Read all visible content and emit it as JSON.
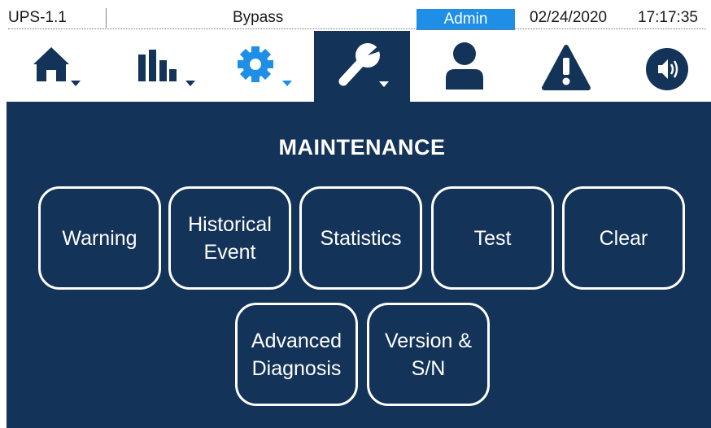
{
  "status_bar": {
    "device_id": "UPS-1.1",
    "mode": "Bypass",
    "user": "Admin",
    "date": "02/24/2020",
    "time": "17:17:35"
  },
  "nav": {
    "tabs": [
      {
        "icon": "home-icon",
        "active": false,
        "has_dropdown": true
      },
      {
        "icon": "bar-chart-icon",
        "active": false,
        "has_dropdown": true
      },
      {
        "icon": "gear-icon",
        "active": false,
        "has_dropdown": true
      },
      {
        "icon": "wrench-icon",
        "active": true,
        "has_dropdown": true
      },
      {
        "icon": "user-icon",
        "active": false,
        "has_dropdown": false
      },
      {
        "icon": "warning-icon",
        "active": false,
        "has_dropdown": false
      },
      {
        "icon": "speaker-icon",
        "active": false,
        "has_dropdown": false
      }
    ]
  },
  "page": {
    "title": "MAINTENANCE"
  },
  "buttons": {
    "warning": [
      "Warning"
    ],
    "historical_event": [
      "Historical",
      "Event"
    ],
    "statistics": [
      "Statistics"
    ],
    "test": [
      "Test"
    ],
    "clear": [
      "Clear"
    ],
    "advanced_diagnosis": [
      "Advanced",
      "Diagnosis"
    ],
    "version_sn": [
      "Version &",
      "S/N"
    ]
  },
  "colors": {
    "panel": "#143359",
    "icon": "#143359",
    "gear_accent": "#1e8ee6",
    "user_badge": "#1e8ee6",
    "button_border": "#ffffff"
  }
}
